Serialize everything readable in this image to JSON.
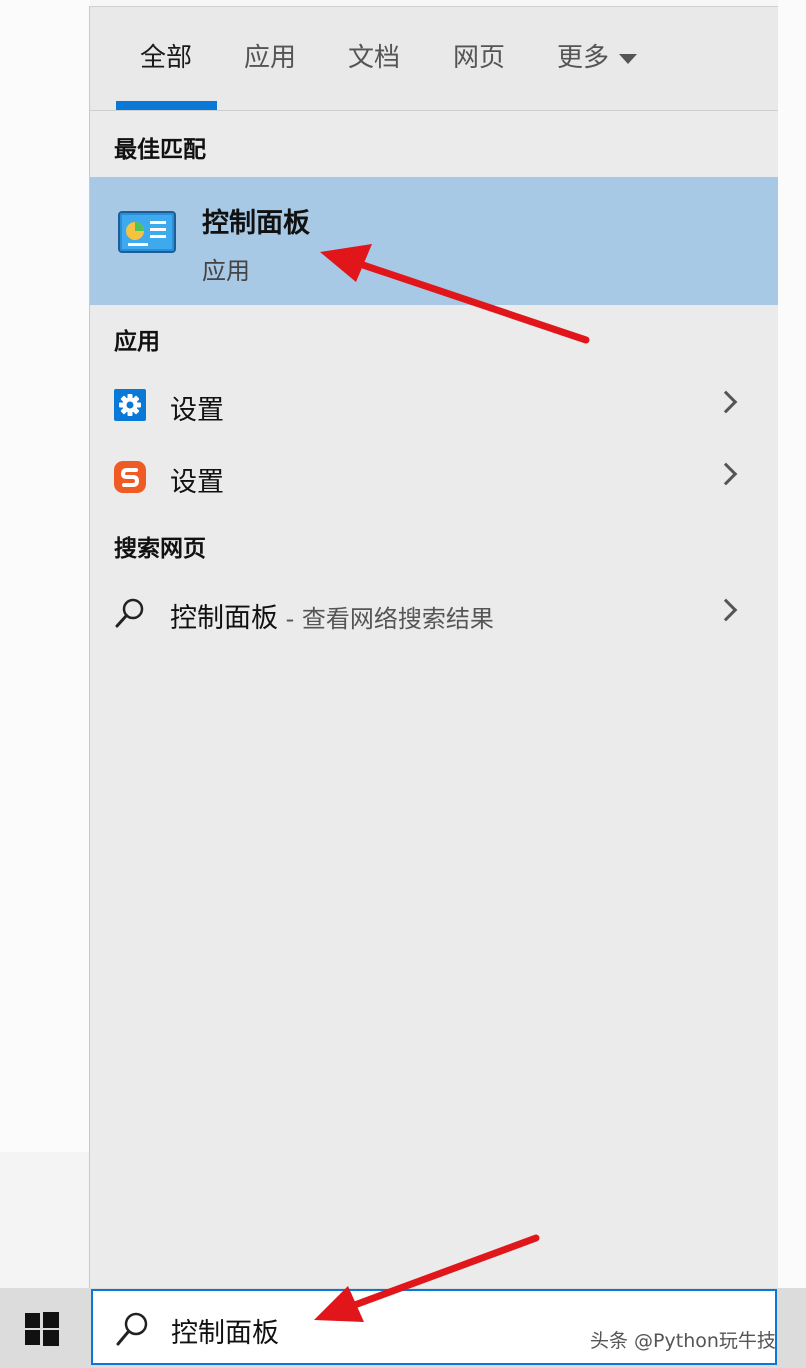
{
  "tabs": [
    {
      "label": "全部",
      "active": true
    },
    {
      "label": "应用"
    },
    {
      "label": "文档"
    },
    {
      "label": "网页"
    },
    {
      "label": "更多"
    }
  ],
  "sections": {
    "best_match": "最佳匹配",
    "apps": "应用",
    "web": "搜索网页"
  },
  "best_match_item": {
    "title": "控制面板",
    "subtitle": "应用"
  },
  "apps": [
    {
      "label": "设置",
      "icon": "gear-icon"
    },
    {
      "label": "设置",
      "icon": "sogou-s-icon"
    }
  ],
  "web_result": {
    "query": "控制面板",
    "suffix": " - 查看网络搜索结果"
  },
  "search_box": {
    "value": "控制面板"
  },
  "watermark": "头条 @Python玩牛技",
  "colors": {
    "accent": "#0a78d7",
    "highlight": "#a8c9e5",
    "annotation_arrow": "#e0161a"
  }
}
